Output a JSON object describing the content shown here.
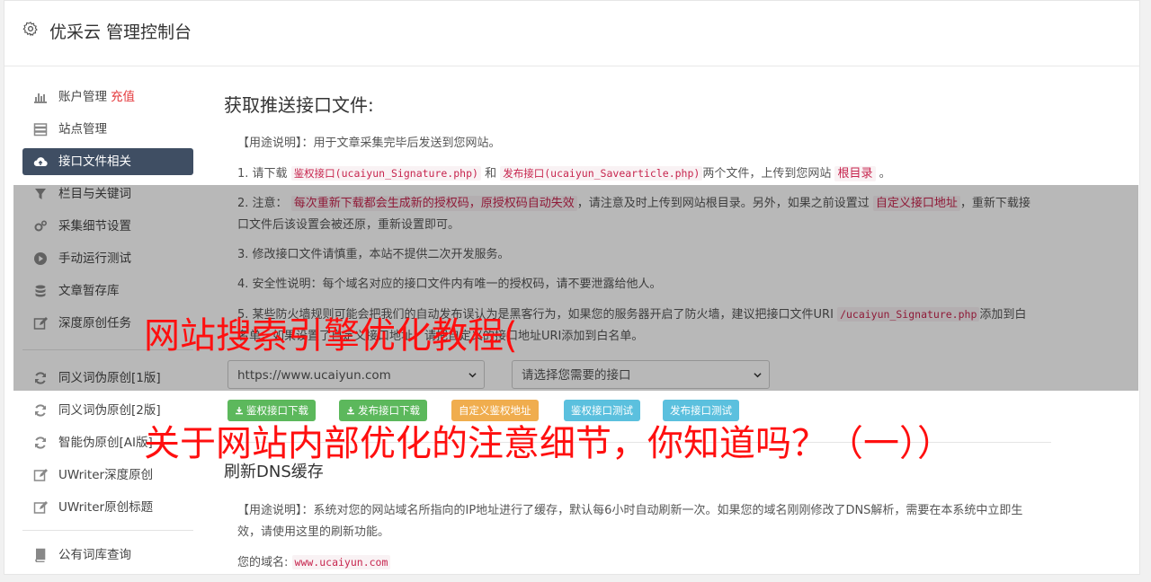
{
  "header": {
    "title": "优采云 管理控制台"
  },
  "sidebar": {
    "items": [
      {
        "label": "账户管理",
        "extra": "充值",
        "icon": "bar-chart-icon"
      },
      {
        "label": "站点管理",
        "icon": "server-icon"
      },
      {
        "label": "接口文件相关",
        "icon": "cloud-upload-icon",
        "active": true
      },
      {
        "label": "栏目与关键词",
        "icon": "filter-icon"
      },
      {
        "label": "采集细节设置",
        "icon": "gears-icon"
      },
      {
        "label": "手动运行测试",
        "icon": "play-circle-icon"
      },
      {
        "label": "文章暂存库",
        "icon": "database-icon"
      },
      {
        "label": "深度原创任务",
        "icon": "edit-icon"
      }
    ],
    "items2": [
      {
        "label": "同义词伪原创[1版]",
        "icon": "refresh-icon"
      },
      {
        "label": "同义词伪原创[2版]",
        "icon": "refresh-icon"
      },
      {
        "label": "智能伪原创[AI版]",
        "icon": "refresh-icon"
      },
      {
        "label": "UWriter深度原创",
        "icon": "edit-icon"
      },
      {
        "label": "UWriter原创标题",
        "icon": "edit-icon"
      }
    ],
    "items3": [
      {
        "label": "公有词库查询",
        "icon": "book-icon"
      }
    ]
  },
  "main": {
    "section1_title": "获取推送接口文件:",
    "usage": "【用途说明】：用于文章采集完毕后发送到您网站。",
    "p1": {
      "a": "1. 请下载",
      "code1": "鉴权接口(ucaiyun_Signature.php)",
      "b": "和",
      "code2": "发布接口(ucaiyun_Savearticle.php)",
      "c": "两个文件，上传到您网站",
      "hl": "根目录",
      "d": "。"
    },
    "p2": {
      "a": "2. 注意：",
      "hl1": "每次重新下载都会生成新的授权码，原授权码自动失效",
      "b": "，请注意及时上传到网站根目录。另外，如果之前设置过",
      "hl2": "自定义接口地址",
      "c": "，重新下载接口文件后该设置会被还原，重新设置即可。"
    },
    "p3": "3. 修改接口文件请慎重，本站不提供二次开发服务。",
    "p4": "4. 安全性说明：每个域名对应的接口文件内有唯一的授权码，请不要泄露给他人。",
    "p5": {
      "a": "5. 某些防火墙规则可能会把我们的自动发布误认为是黑客行为，如果您的服务器开启了防火墙，建议把接口文件URI",
      "code": "/ucaiyun_Signature.php",
      "b": "添加到白名单，如果设置了自定义接口地址，请把自定义的接口地址URI添加到白名单。"
    },
    "select_site": "https://www.ucaiyun.com",
    "select_api": "请选择您需要的接口",
    "buttons": {
      "sign_download": "鉴权接口下载",
      "publish_download": "发布接口下载",
      "custom_sign": "自定义鉴权地址",
      "sign_test": "鉴权接口测试",
      "publish_test": "发布接口测试"
    },
    "section2_title": "刷新DNS缓存",
    "dns_usage": "【用途说明】：系统对您的网站域名所指向的IP地址进行了缓存，默认每6小时自动刷新一次。如果您的域名刚刚修改了DNS解析，需要在本系统中立即生效，请使用这里的刷新功能。",
    "domain_label": "您的域名:",
    "domain_value": "www.ucaiyun.com"
  },
  "overlay": {
    "line1": "网站搜索引擎优化教程(",
    "line2": "关于网站内部优化的注意细节，你知道吗？（一））"
  },
  "colors": {
    "sidebar_active": "#3f4e63",
    "green": "#5cb85c",
    "orange": "#f0ad4e",
    "blue": "#5bc0de",
    "overlay_text": "#ff0f0f"
  }
}
